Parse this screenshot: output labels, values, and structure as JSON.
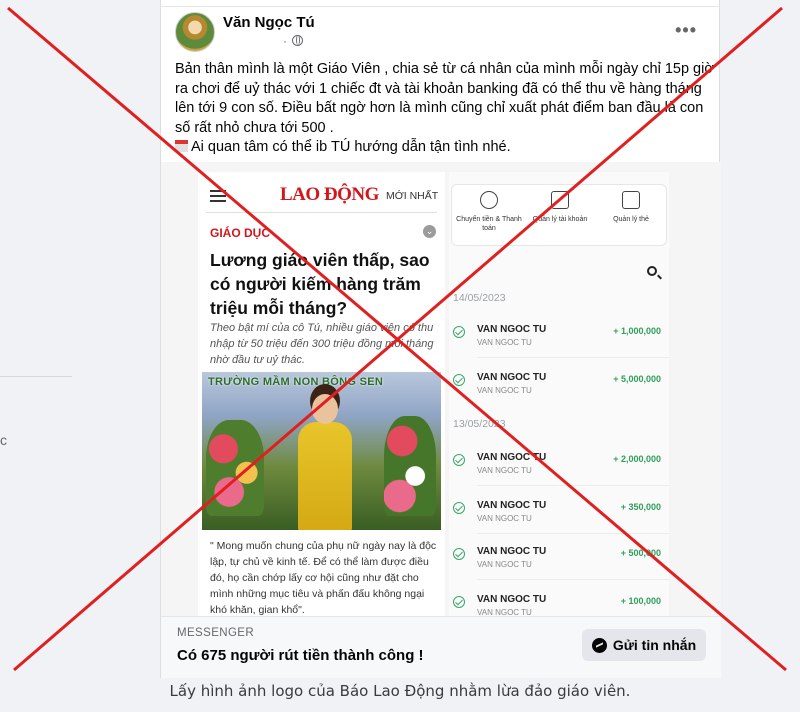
{
  "post": {
    "author": "Văn Ngọc Tú",
    "meta": "·",
    "text_lines": [
      "Bản thân mình là một Giáo Viên , chia sẻ từ cá nhân của mình mỗi ngày chỉ 15p giờ ra chơi để  uỷ thác với 1 chiếc đt và tài khoản banking đã có thể thu về hàng tháng lên tới 9 con số. Điều bất ngờ hơn là mình cũng chỉ xuất phát điểm ban đầu là con số rất nhỏ chưa tới 500 .",
      "Ai quan tâm có thể ib TÚ hướng dẫn tận tình nhé."
    ]
  },
  "news": {
    "logo": "LAO ĐỘNG",
    "newest": "MỚI NHẤT",
    "category": "GIÁO DỤC",
    "headline": "Lương giáo viên thấp, sao có người kiếm hàng trăm triệu mỗi tháng?",
    "sapo": "Theo bật mí của cô Tú, nhiều giáo viên có thu nhập từ 50 triệu đến 300 triệu đồng mỗi tháng nhờ đầu tư uỷ thác.",
    "photo_banner": "TRƯỜNG MẦM NON BÔNG SEN",
    "quote": "\" Mong muốn chung của phụ nữ ngày nay là độc lập, tự chủ về kinh tế. Để có thể làm được điều đó, họ cần chớp lấy cơ hội cũng như đặt cho mình những mục tiêu và phấn đấu không ngại khó khăn, gian khổ\"."
  },
  "bank": {
    "actions": [
      {
        "label": "Chuyển tiền & Thanh toán",
        "icon": "transfer-icon"
      },
      {
        "label": "Quản lý tài khoản",
        "icon": "wallet-icon"
      },
      {
        "label": "Quản lý thẻ",
        "icon": "card-icon"
      }
    ],
    "dates": [
      "14/05/2023",
      "13/05/2023"
    ],
    "transactions": [
      {
        "name": "VAN NGOC TU",
        "sub": "VAN NGOC TU",
        "amount": "+ 1,000,000"
      },
      {
        "name": "VAN NGOC TU",
        "sub": "VAN NGOC TU",
        "amount": "+ 5,000,000"
      },
      {
        "name": "VAN NGOC TU",
        "sub": "VAN NGOC TU",
        "amount": "+ 2,000,000"
      },
      {
        "name": "VAN NGOC TU",
        "sub": "VAN NGOC TU",
        "amount": "+ 350,000"
      },
      {
        "name": "VAN NGOC TU",
        "sub": "VAN NGOC TU",
        "amount": "+ 500,000"
      },
      {
        "name": "VAN NGOC TU",
        "sub": "VAN NGOC TU",
        "amount": "+ 100,000"
      }
    ]
  },
  "footer": {
    "kicker": "MESSENGER",
    "title": "Có 675 người rút tiền thành công !",
    "send_label": "Gửi tin nhắn"
  },
  "caption": "Lấy hình ảnh logo của Báo Lao Động nhằm lừa đảo giáo viên.",
  "left_glyph": "c",
  "colors": {
    "cross": "#e02020",
    "brand_red": "#d4161c",
    "money_green": "#2e9e5b"
  }
}
